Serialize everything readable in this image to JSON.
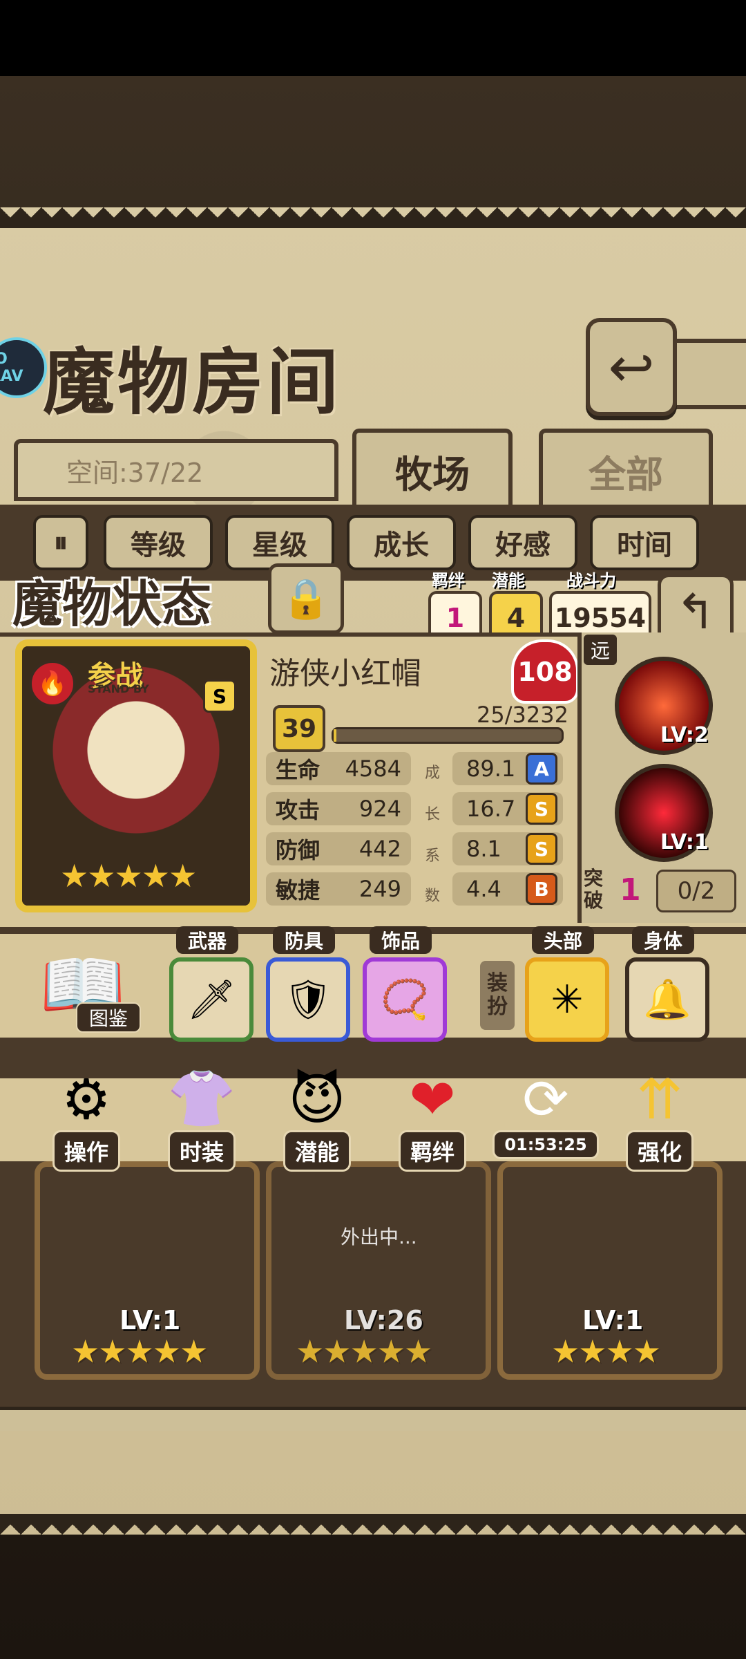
{
  "header": {
    "title": "魔物房间",
    "logo_text": "JO AAV"
  },
  "storage": {
    "space_text": "空间:37/22"
  },
  "tabs": [
    {
      "label": "牧场"
    },
    {
      "label": "全部"
    }
  ],
  "filters": [
    "等级",
    "星级",
    "成长",
    "好感",
    "时间"
  ],
  "status_panel": {
    "title": "魔物状态",
    "bond_label": "羁绊",
    "bond_value": "1",
    "potential_label": "潜能",
    "potential_value": "4",
    "power_label": "战斗力",
    "power_value": "19554",
    "standby_text": "参战",
    "standby_sub": "STAND BY",
    "rank_badge": "S",
    "name": "游侠小红帽",
    "affection": "108",
    "level": "39",
    "xp_text": "25/3232",
    "xp_fraction": 0.008,
    "star_count": 5,
    "stats": [
      {
        "label": "生命",
        "value": "4584",
        "growth": "89.1",
        "grade": "A"
      },
      {
        "label": "攻击",
        "value": "924",
        "growth": "16.7",
        "grade": "S"
      },
      {
        "label": "防御",
        "value": "442",
        "growth": "8.1",
        "grade": "S"
      },
      {
        "label": "敏捷",
        "value": "249",
        "growth": "4.4",
        "grade": "B"
      }
    ],
    "growth_caption": [
      "成",
      "长",
      "系",
      "数"
    ],
    "range_tag": "远",
    "skills": [
      {
        "level": "LV:2"
      },
      {
        "level": "LV:1"
      }
    ],
    "breakthrough_label_1": "突",
    "breakthrough_label_2": "破",
    "breakthrough_value": "1",
    "breakthrough_progress": "0/2"
  },
  "equipment": {
    "codex_label": "图鉴",
    "slots": [
      {
        "label": "武器"
      },
      {
        "label": "防具"
      },
      {
        "label": "饰品"
      }
    ],
    "dress_label": "装扮",
    "dress_slots": [
      {
        "label": "头部"
      },
      {
        "label": "身体"
      }
    ]
  },
  "actions": [
    {
      "label": "操作"
    },
    {
      "label": "时装"
    },
    {
      "label": "潜能"
    },
    {
      "label": "羁绊"
    },
    {
      "label": "01:53:25"
    },
    {
      "label": "强化"
    }
  ],
  "monster_cards": [
    {
      "level": "LV:1",
      "stars": "★★★★★"
    },
    {
      "level": "LV:26",
      "status": "外出中...",
      "stars": "★★★★★"
    },
    {
      "level": "LV:1",
      "stars": "★★★★"
    }
  ],
  "colors": {
    "panel": "#d8c79b",
    "border": "#4a3a2a",
    "gold": "#e7c23a",
    "grade_A": "#3a6fd6",
    "grade_S": "#e7a21a",
    "grade_B": "#d65a1a",
    "heart": "#c6202a"
  }
}
